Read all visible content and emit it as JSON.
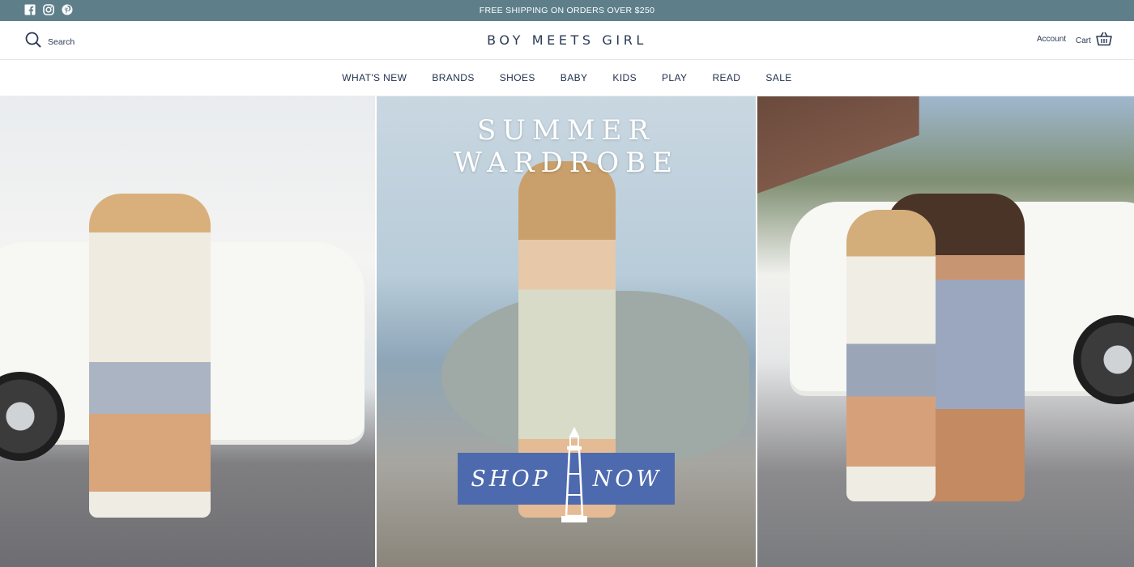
{
  "announcement": {
    "text": "FREE SHIPPING ON ORDERS OVER $250"
  },
  "social": [
    "facebook-icon",
    "instagram-icon",
    "pinterest-icon"
  ],
  "header": {
    "search_label": "Search",
    "logo": "BOY MEETS GIRL",
    "account_label": "Account",
    "cart_label": "Cart"
  },
  "nav": {
    "items": [
      "WHAT'S NEW",
      "BRANDS",
      "SHOES",
      "BABY",
      "KIDS",
      "PLAY",
      "READ",
      "SALE"
    ]
  },
  "hero": {
    "headline": "SUMMER WARDROBE",
    "cta_left": "SHOP",
    "cta_right": "NOW"
  },
  "colors": {
    "announcement_bg": "#5e7f8a",
    "text_navy": "#2b3a55",
    "cta_blue": "#4e6aae"
  }
}
